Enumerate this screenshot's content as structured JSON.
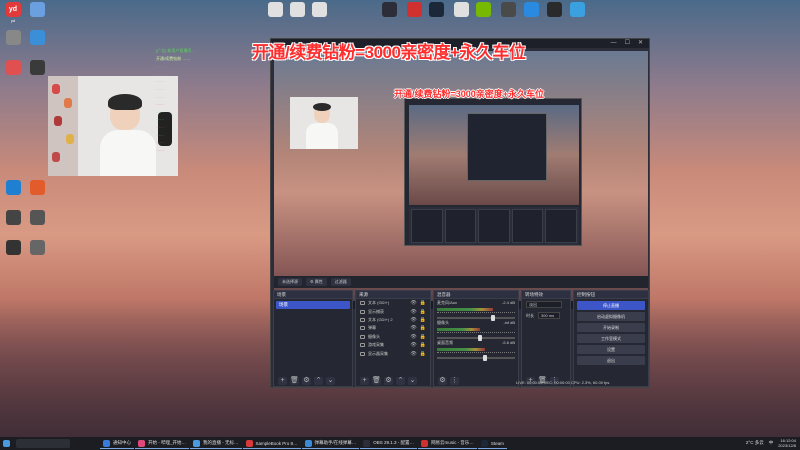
{
  "colors": {
    "accent": "#3c56c8",
    "banner": "#ff2d2d",
    "obs_bg": "#2b2e38",
    "taskbar": "#1b1d22"
  },
  "banner_text": "开通/续费钻粉=3000亲密度+永久车位",
  "desktop_icons": [
    {
      "label": "yd",
      "color": "#e23a3a",
      "icon": "youdao-icon"
    },
    {
      "label": "",
      "color": "#6aa0e0",
      "icon": "computer-icon"
    },
    {
      "label": "",
      "color": "#888",
      "icon": "recycle-bin-icon"
    },
    {
      "label": "",
      "color": "#3a8fd8",
      "icon": "network-icon"
    },
    {
      "label": "",
      "color": "#e05050",
      "icon": "app-icon"
    },
    {
      "label": "",
      "color": "#3a3a3a",
      "icon": "game-icon"
    },
    {
      "label": "",
      "color": "#1f7fd0",
      "icon": "app-icon"
    },
    {
      "label": "",
      "color": "#e25b2a",
      "icon": "app-icon"
    },
    {
      "label": "",
      "color": "#444",
      "icon": "app-icon"
    },
    {
      "label": "",
      "color": "#555",
      "icon": "app-icon"
    },
    {
      "label": "",
      "color": "#333",
      "icon": "app-icon"
    },
    {
      "label": "",
      "color": "#666",
      "icon": "app-icon"
    }
  ],
  "top_icons": [
    {
      "color": "#e0e0e0",
      "icon": "file-icon"
    },
    {
      "color": "#e0e0e0",
      "icon": "file-icon"
    },
    {
      "color": "#e0e0e0",
      "icon": "file-icon"
    },
    {
      "color": "#2d2d3a",
      "icon": "obs-icon"
    },
    {
      "color": "#d03030",
      "icon": "netease-music-icon"
    },
    {
      "color": "#1b2838",
      "icon": "steam-icon"
    },
    {
      "color": "#e0e0e0",
      "icon": "file-icon"
    },
    {
      "color": "#76b900",
      "icon": "nvidia-icon"
    },
    {
      "color": "#4a4a4a",
      "icon": "app-icon"
    },
    {
      "color": "#2a8ae0",
      "icon": "app-icon"
    },
    {
      "color": "#2a2a2a",
      "icon": "qq-icon"
    },
    {
      "color": "#3aa0e0",
      "icon": "app-icon"
    }
  ],
  "chat": [
    {
      "text": "[广告] 新用户直播间 …",
      "color": "#5ad35a"
    },
    {
      "text": "开通/续费钻粉 ……",
      "color": "#d0f0a0"
    },
    {
      "text": "",
      "color": "#5ad35a"
    },
    {
      "text": "……",
      "color": "#5ad35a"
    },
    {
      "text": "……",
      "color": "#5ad35a"
    },
    {
      "text": "……",
      "color": "#5ad35a"
    },
    {
      "text": "……",
      "color": "#5ad35a"
    },
    {
      "text": "……",
      "color": "#5ad35a"
    },
    {
      "text": "……",
      "color": "#e34a4a"
    },
    {
      "text": "……",
      "color": "#5ad35a"
    },
    {
      "text": "……",
      "color": "#5ad35a"
    },
    {
      "text": "……",
      "color": "#e34a4a"
    },
    {
      "text": "……",
      "color": "#5ad35a"
    },
    {
      "text": "……",
      "color": "#e34a4a"
    },
    {
      "text": "……",
      "color": "#e34a4a"
    }
  ],
  "obs": {
    "window_controls": [
      "—",
      "☐",
      "✕"
    ],
    "preview_banner": "开通/续费钻粉=3000亲密度+永久车位",
    "scene_bar": [
      "未选择源",
      "⚙ 属性",
      "过滤器"
    ],
    "scenes_title": "场景",
    "scenes": [
      "场景"
    ],
    "sources_title": "来源",
    "sources": [
      "文本 (GDI+)",
      "显示捕获",
      "文本 (GDI+) 2",
      "弹幕",
      "摄像头",
      "游戏采集",
      "显示器采集"
    ],
    "mixer_title": "混音器",
    "mixer": [
      {
        "name": "麦克风/Aux",
        "db": "-2.4 dB",
        "level": 0.72
      },
      {
        "name": "摄像头",
        "db": "-inf dB",
        "level": 0.55
      },
      {
        "name": "桌面音频",
        "db": "-5.6 dB",
        "level": 0.62
      }
    ],
    "transitions_title": "转场特效",
    "transition_value": "淡出",
    "duration_label": "时长",
    "duration_value": "300 ms",
    "controls_title": "控制按钮",
    "controls": [
      "停止直播",
      "启动虚拟摄像机",
      "开始录制",
      "工作室模式",
      "设置",
      "退出"
    ],
    "status": "LIVE: 00:00:00     REC: 00:00:00     CPU: 2.3%, 60.00 fps"
  },
  "taskbar": {
    "search_placeholder": "",
    "apps": [
      {
        "label": "通知中心",
        "color": "#3a7ad8"
      },
      {
        "label": "开始 - 哔哩_开始…",
        "color": "#e04a7a"
      },
      {
        "label": "我的直播 - 无标…",
        "color": "#4a9ae0"
      },
      {
        "label": "SampleBook Pro 8…",
        "color": "#d83a3a"
      },
      {
        "label": "弹幕助手/在线弹幕…",
        "color": "#3a8ad8"
      },
      {
        "label": "OBS 29.1.3 - 配置…",
        "color": "#2d2d3a"
      },
      {
        "label": "网易云music - 音乐…",
        "color": "#d03030"
      },
      {
        "label": "Steam",
        "color": "#1b2838"
      }
    ],
    "weather": "2°C 多云",
    "lang": "中",
    "time": "16:12:04",
    "date": "2023/12/8"
  }
}
